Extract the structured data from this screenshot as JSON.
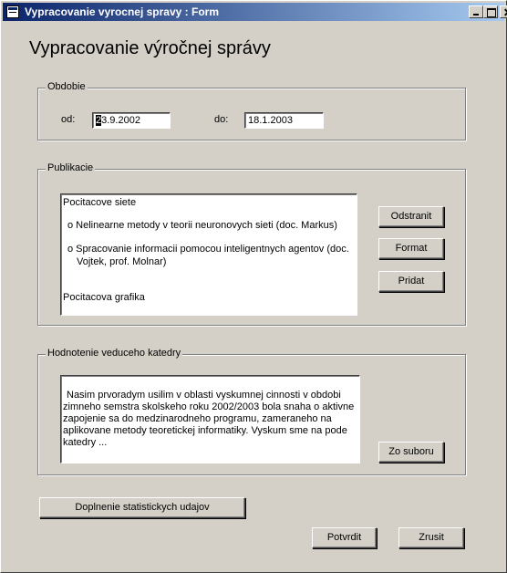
{
  "window": {
    "title": "Vypracovanie vyrocnej spravy : Form"
  },
  "form": {
    "title": "Vypracovanie výročnej správy"
  },
  "obdobie": {
    "group_label": "Obdobie",
    "od_label": "od:",
    "od_value_selected": "2",
    "od_value_rest": "3.9.2002",
    "do_label": "do:",
    "do_value": "18.1.2003"
  },
  "publikacie": {
    "group_label": "Publikacie",
    "items": [
      "Pocitacove siete",
      "o Nelinearne metody v teorii neuronovych sieti (doc. Markus)",
      "o Spracovanie informacii pomocou inteligentnych agentov (doc.",
      "Vojtek, prof. Molnar)",
      "Pocitacova grafika"
    ],
    "btn_odstranit": "Odstranit",
    "btn_format": "Format",
    "btn_pridat": "Pridat"
  },
  "hodnotenie": {
    "group_label": "Hodnotenie veduceho katedry",
    "lines": [
      "Nasim prvoradym usilim v oblasti vyskumnej cinnosti v obdobi",
      "zimneho semstra skolskeho roku 2002/2003 bola snaha o aktivne",
      "zapojenie sa do medzinarodneho programu, zameraneho na",
      "aplikovane metody teoretickej informatiky. Vyskum sme na pode",
      "katedry ..."
    ],
    "btn_zo_suboru": "Zo suboru"
  },
  "footer": {
    "btn_doplnenie": "Doplnenie statistickych udajov",
    "btn_potvrdit": "Potvrdit",
    "btn_zrusit": "Zrusit"
  }
}
